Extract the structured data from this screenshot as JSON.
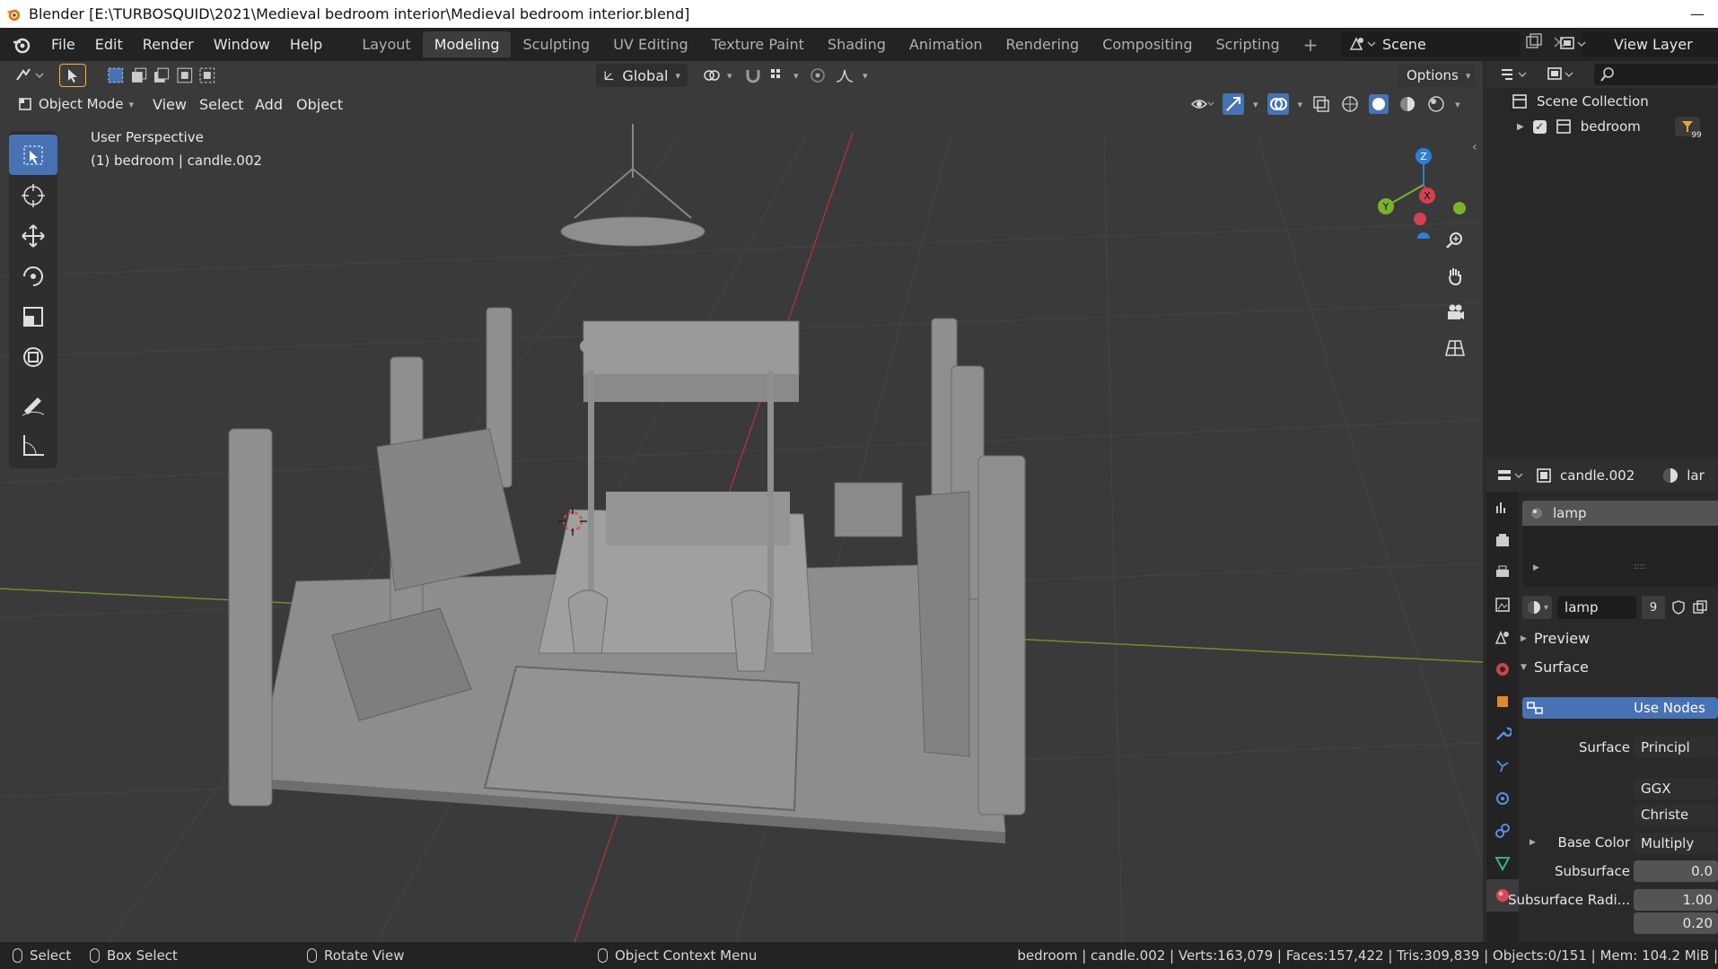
{
  "window": {
    "title": "Blender [E:\\TURBOSQUID\\2021\\Medieval bedroom interior\\Medieval bedroom interior.blend]",
    "controls": [
      "—"
    ]
  },
  "menu": [
    "File",
    "Edit",
    "Render",
    "Window",
    "Help"
  ],
  "workspace_tabs": [
    {
      "label": "Layout",
      "active": false
    },
    {
      "label": "Modeling",
      "active": true
    },
    {
      "label": "Sculpting",
      "active": false
    },
    {
      "label": "UV Editing",
      "active": false
    },
    {
      "label": "Texture Paint",
      "active": false
    },
    {
      "label": "Shading",
      "active": false
    },
    {
      "label": "Animation",
      "active": false
    },
    {
      "label": "Rendering",
      "active": false
    },
    {
      "label": "Compositing",
      "active": false
    },
    {
      "label": "Scripting",
      "active": false
    }
  ],
  "scene": {
    "name": "Scene",
    "view_layer": "View Layer"
  },
  "viewport": {
    "transform_orientation": "Global",
    "options_label": "Options",
    "mode": "Object Mode",
    "header_menu": [
      "View",
      "Select",
      "Add",
      "Object"
    ],
    "perspective_label": "User Perspective",
    "active_object_label": "(1) bedroom | candle.002",
    "gizmo_axes": {
      "z": "Z",
      "y": "Y",
      "x": "X"
    }
  },
  "outliner": {
    "root": "Scene Collection",
    "items": [
      {
        "name": "bedroom",
        "badge": "99"
      }
    ]
  },
  "properties": {
    "object_name": "candle.002",
    "material_tab_label": "lar",
    "material_slot": "lamp",
    "material_name": "lamp",
    "user_count": "9",
    "sections": {
      "preview": "Preview",
      "surface": "Surface"
    },
    "use_nodes": "Use Nodes",
    "rows": [
      {
        "label": "Surface",
        "value": "Principl"
      },
      {
        "label": "",
        "value": "GGX"
      },
      {
        "label": "",
        "value": "Christe"
      },
      {
        "label": "Base Color",
        "value": "Multiply"
      },
      {
        "label": "Subsurface",
        "value": "0.0"
      },
      {
        "label": "Subsurface Radi...",
        "value": "1.00"
      },
      {
        "label": "",
        "value": "0.20"
      }
    ]
  },
  "statusbar": {
    "select": "Select",
    "box_select": "Box Select",
    "rotate_view": "Rotate View",
    "context_menu": "Object Context Menu",
    "stats": "bedroom | candle.002 | Verts:163,079 | Faces:157,422 | Tris:309,839 | Objects:0/151 | Mem: 104.2 MiB |"
  },
  "colors": {
    "accent": "#4772b3",
    "x_axis": "#d64050",
    "y_axis": "#7ab32c",
    "z_axis": "#2f7fd6",
    "grid": "#454545"
  }
}
